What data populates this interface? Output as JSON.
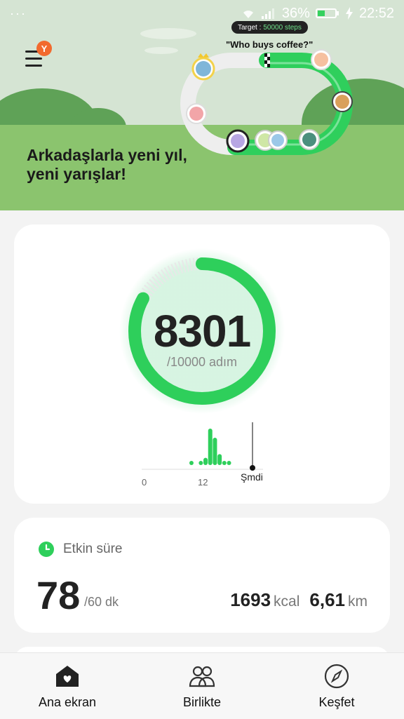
{
  "status_bar": {
    "battery": "36%",
    "time": "22:52"
  },
  "hero": {
    "title_line1": "Arkadaşlarla yeni yıl,",
    "title_line2": "yeni yarışlar!",
    "menu_badge": "Y",
    "target_label": "Target : ",
    "target_value": "50000 steps",
    "race_name": "\"Who buys coffee?\""
  },
  "steps": {
    "current": "8301",
    "goal": "/10000 adım",
    "progress": 0.83
  },
  "hourly_chart": {
    "x_labels": [
      "0",
      "12",
      "Şmdi"
    ],
    "bars": [
      0,
      0,
      0,
      0,
      0,
      0,
      0,
      0,
      0,
      0,
      0.05,
      0,
      0.05,
      0.2,
      1.0,
      0.75,
      0.3,
      0.05,
      0.05,
      0,
      0,
      0,
      0,
      0
    ]
  },
  "active_time": {
    "label": "Etkin süre",
    "value": "78",
    "goal": "/60 dk"
  },
  "energy": {
    "kcal": "1693",
    "kcal_unit": "kcal",
    "km": "6,61",
    "km_unit": "km"
  },
  "colors": {
    "accent_green": "#22c55e",
    "hero_green": "#8bc46e",
    "badge_orange": "#f26a2e"
  },
  "nav": [
    {
      "label": "Ana ekran",
      "icon": "home-heart-icon"
    },
    {
      "label": "Birlikte",
      "icon": "people-icon"
    },
    {
      "label": "Keşfet",
      "icon": "compass-icon"
    }
  ]
}
